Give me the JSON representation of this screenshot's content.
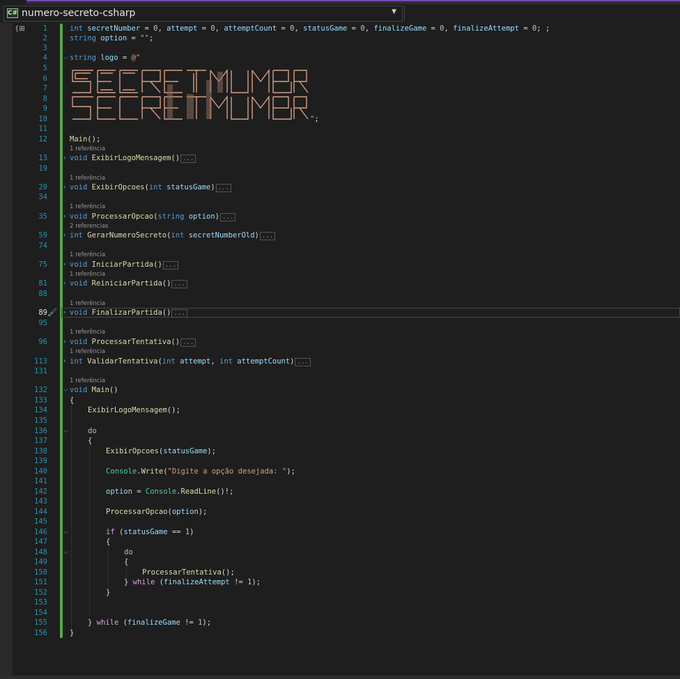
{
  "navbar": {
    "project_label": "numero-secreto-csharp",
    "lang_badge": "C#"
  },
  "code_lens": {
    "one": "1 referência",
    "two": "2 referencias"
  },
  "line_numbers": {
    "n1": "1",
    "n2": "2",
    "n3": "3",
    "n4": "4",
    "n5": "5",
    "n6": "6",
    "n7": "7",
    "n8": "8",
    "n9": "9",
    "n10": "10",
    "n11": "11",
    "n12": "12",
    "n13": "13",
    "n19": "19",
    "n20": "20",
    "n34": "34",
    "n35": "35",
    "n59": "59",
    "n74": "74",
    "n75": "75",
    "n81": "81",
    "n88": "88",
    "n89": "89",
    "n95": "95",
    "n96": "96",
    "n113": "113",
    "n131": "131",
    "n132": "132",
    "n133": "133",
    "n134": "134",
    "n135": "135",
    "n136": "136",
    "n137": "137",
    "n138": "138",
    "n139": "139",
    "n140": "140",
    "n141": "141",
    "n142": "142",
    "n143": "143",
    "n144": "144",
    "n145": "145",
    "n146": "146",
    "n147": "147",
    "n148": "148",
    "n149": "149",
    "n150": "150",
    "n151": "151",
    "n152": "152",
    "n153": "153",
    "n154": "154",
    "n155": "155",
    "n156": "156"
  },
  "code": {
    "l1": {
      "kw_int": "int",
      "v1": "secretNumber",
      "eq": " = ",
      "z": "0",
      "c": ", ",
      "v2": "attempt",
      "v3": "attemptCount",
      "v4": "statusGame",
      "v5": "finalizeGame",
      "v6": "finalizeAttempt",
      "end": "; ;"
    },
    "l2": {
      "kw": "string",
      "var": "option",
      "rest": " = ",
      "str": "\"\"",
      "semi": ";"
    },
    "l4": {
      "kw": "string",
      "var": "logo",
      "eq": " = ",
      "str": "@\""
    },
    "l10": {
      "str": "\"",
      "semi": ";"
    },
    "l12": {
      "fn": "Main",
      "rest": "();"
    },
    "l13": {
      "kw": "void",
      "fn": "ExibirLogoMensagem",
      "rest": "()"
    },
    "l20": {
      "kw": "void",
      "fn": "ExibirOpcoes",
      "p1": "(",
      "ptype": "int",
      "pname": "statusGame",
      "p2": ")"
    },
    "l35": {
      "kw": "void",
      "fn": "ProcessarOpcao",
      "p1": "(",
      "ptype": "string",
      "pname": "option",
      "p2": ")"
    },
    "l59": {
      "kw": "int",
      "fn": "GerarNumeroSecreto",
      "p1": "(",
      "ptype": "int",
      "pname": "secretNumberOld",
      "p2": ")"
    },
    "l75": {
      "kw": "void",
      "fn": "IniciarPartida",
      "rest": "()"
    },
    "l81": {
      "kw": "void",
      "fn": "ReiniciarPartida",
      "rest": "()"
    },
    "l89": {
      "kw": "void",
      "fn": "FinalizarPartida",
      "rest": "()"
    },
    "l96": {
      "kw": "void",
      "fn": "ProcessarTentativa",
      "rest": "()"
    },
    "l113": {
      "kw": "int",
      "fn": "ValidarTentativa",
      "p1": "(",
      "ptype": "int",
      "pname": "attempt",
      "c": ", ",
      "ptype2": "int",
      "pname2": "attemptCount",
      "p2": ")"
    },
    "l132": {
      "kw": "void",
      "fn": "Main",
      "rest": "()"
    },
    "l133": {
      "text": "{"
    },
    "l134": {
      "fn": "ExibirLogoMensagem",
      "rest": "();"
    },
    "l136": {
      "kw": "do"
    },
    "l137": {
      "text": "{"
    },
    "l138": {
      "fn": "ExibirOpcoes",
      "p1": "(",
      "arg": "statusGame",
      "p2": ");"
    },
    "l140": {
      "typ": "Console",
      "dot": ".",
      "fn": "Write",
      "p1": "(",
      "str": "\"Digite a opção desejada: \"",
      "p2": ");"
    },
    "l142": {
      "var": "option",
      "eq": " = ",
      "typ": "Console",
      "dot": ".",
      "fn": "ReadLine",
      "rest": "()!;"
    },
    "l144": {
      "fn": "ProcessarOpcao",
      "p1": "(",
      "arg": "option",
      "p2": ");"
    },
    "l146": {
      "kw": "if",
      "p1": " (",
      "var": "statusGame",
      "op": " == ",
      "num": "1",
      "p2": ")"
    },
    "l147": {
      "text": "{"
    },
    "l148": {
      "kw": "do"
    },
    "l149": {
      "text": "{"
    },
    "l150": {
      "fn": "ProcessarTentativa",
      "rest": "();"
    },
    "l151": {
      "br": "} ",
      "kw": "while",
      "p1": " (",
      "var": "finalizeAttempt",
      "op": " != ",
      "num": "1",
      "p2": ");"
    },
    "l152": {
      "text": "}"
    },
    "l155": {
      "br": "} ",
      "kw": "while",
      "p1": " (",
      "var": "finalizeGame",
      "op": " != ",
      "num": "1",
      "p2": ");"
    },
    "l156": {
      "text": "}"
    }
  },
  "collapsed": "...",
  "colors": {
    "keyword": "#569cd6",
    "control": "#d8a0df",
    "identifier": "#9cdcfe",
    "function": "#dcdcaa",
    "string": "#d69d85",
    "number": "#b5cea8",
    "type": "#4ec9b0",
    "change_bar": "#57a64a",
    "line_number": "#2b91af"
  },
  "icons": [
    "csharp-file-icon",
    "dropdown-chevron-icon",
    "fold-chevron-icon",
    "quick-actions-brush-icon",
    "expand-collapse-icon"
  ]
}
